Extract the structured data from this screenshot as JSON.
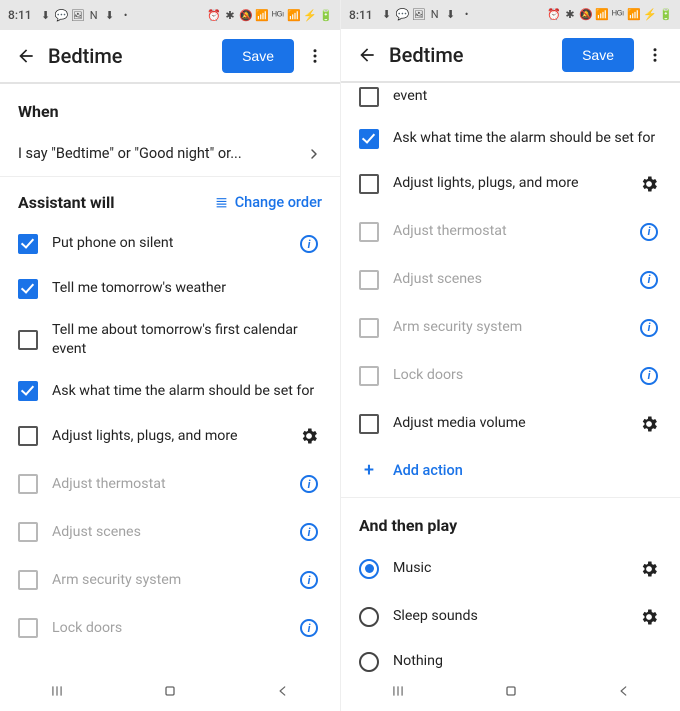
{
  "status": {
    "time": "8:11",
    "left_icons": [
      "⬇",
      "💬",
      "🖼",
      "N",
      "⬇",
      "•"
    ],
    "right_icons": [
      "⏰",
      "✱",
      "🔕",
      "📶",
      "ᴴᴳᶦ",
      "📶",
      "⚡",
      "🔋"
    ]
  },
  "appbar": {
    "title": "Bedtime",
    "save_label": "Save"
  },
  "left": {
    "when_header": "When",
    "trigger_text": "I say \"Bedtime\" or \"Good night\" or...",
    "assistant_header": "Assistant will",
    "change_order": "Change order",
    "actions": [
      {
        "label": "Put phone on silent",
        "checked": true,
        "trail": "info"
      },
      {
        "label": "Tell me tomorrow's weather",
        "checked": true,
        "trail": null
      },
      {
        "label": "Tell me about tomorrow's first calendar event",
        "checked": false,
        "trail": null
      },
      {
        "label": "Ask what time the alarm should be set for",
        "checked": true,
        "trail": null
      },
      {
        "label": "Adjust lights, plugs, and more",
        "checked": false,
        "trail": "gear"
      },
      {
        "label": "Adjust thermostat",
        "checked": false,
        "trail": "info",
        "disabled": true
      },
      {
        "label": "Adjust scenes",
        "checked": false,
        "trail": "info",
        "disabled": true
      },
      {
        "label": "Arm security system",
        "checked": false,
        "trail": "info",
        "disabled": true
      },
      {
        "label": "Lock doors",
        "checked": false,
        "trail": "info",
        "disabled": true
      }
    ]
  },
  "right": {
    "actions_top_fragment": {
      "label": "event",
      "checked": false
    },
    "actions": [
      {
        "label": "Ask what time the alarm should be set for",
        "checked": true,
        "trail": null
      },
      {
        "label": "Adjust lights, plugs, and more",
        "checked": false,
        "trail": "gear"
      },
      {
        "label": "Adjust thermostat",
        "checked": false,
        "trail": "info",
        "disabled": true
      },
      {
        "label": "Adjust scenes",
        "checked": false,
        "trail": "info",
        "disabled": true
      },
      {
        "label": "Arm security system",
        "checked": false,
        "trail": "info",
        "disabled": true
      },
      {
        "label": "Lock doors",
        "checked": false,
        "trail": "info",
        "disabled": true
      },
      {
        "label": "Adjust media volume",
        "checked": false,
        "trail": "gear"
      }
    ],
    "add_action": "Add action",
    "then_play_header": "And then play",
    "play_options": [
      {
        "label": "Music",
        "selected": true,
        "trail": "gear"
      },
      {
        "label": "Sleep sounds",
        "selected": false,
        "trail": "gear"
      },
      {
        "label": "Nothing",
        "selected": false,
        "trail": null
      }
    ]
  }
}
